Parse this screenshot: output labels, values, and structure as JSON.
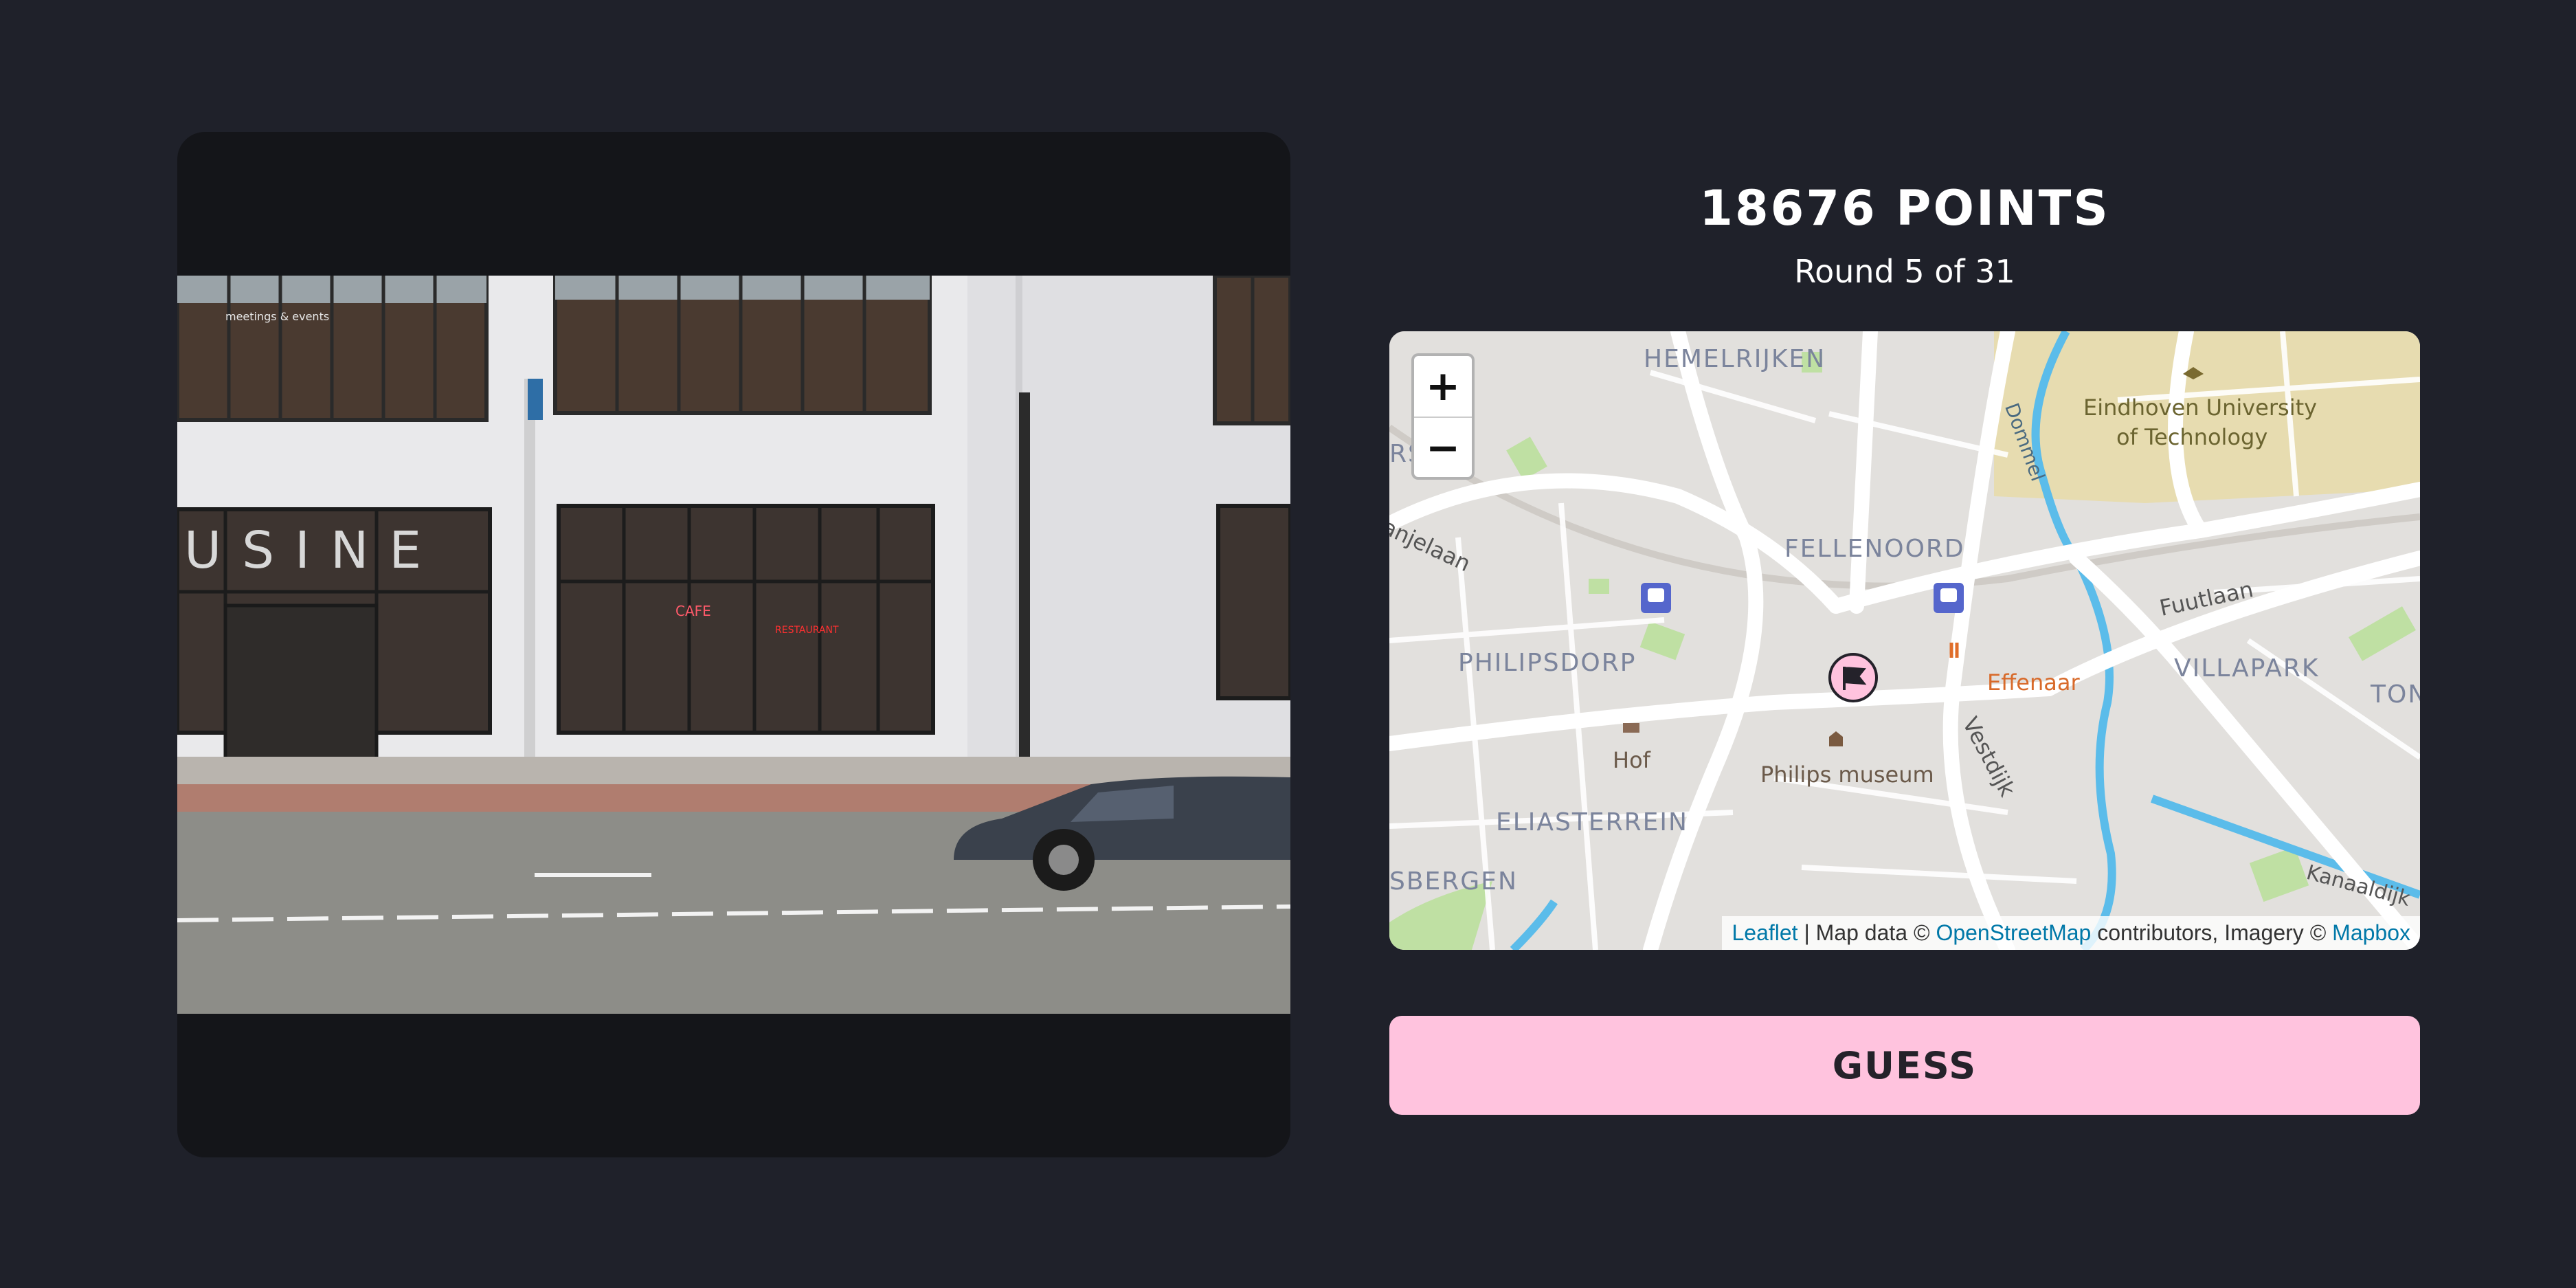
{
  "score": {
    "points": "18676 POINTS",
    "round": "Round 5 of 31"
  },
  "photo": {
    "signage": "USINE",
    "sign_cafe": "CAFE",
    "sign_restaurant": "RESTAURANT",
    "sign_meetings": "meetings & events"
  },
  "map": {
    "zoom_in": "+",
    "zoom_out": "−",
    "labels": {
      "hemelrijken": "HEMELRIJKEN",
      "university": "Eindhoven University",
      "university2": "of Technology",
      "dommel": "Dommel",
      "fellenoord": "FELLENOORD",
      "fuutlaan": "Fuutlaan",
      "anjelaan": "anjelaan",
      "philipsdorp": "PHILIPSDORP",
      "effenaar": "Effenaar",
      "villapark": "VILLAPARK",
      "ton": "TON",
      "hof": "Hof",
      "philips_museum": "Philips museum",
      "vestdijk": "Vestdijk",
      "eliasterrein": "ELIASTERREIN",
      "sbergen": "SBERGEN",
      "kanaaldijk": "Kanaaldijk",
      "rs": "RS"
    },
    "attribution": {
      "leaflet": "Leaflet",
      "sep1": " | Map data © ",
      "osm": "OpenStreetMap",
      "sep2": " contributors, Imagery © ",
      "mapbox": "Mapbox"
    }
  },
  "guess_button": "GUESS",
  "colors": {
    "background": "#1f212a",
    "accent": "#ffc3de",
    "link": "#0078a8"
  }
}
